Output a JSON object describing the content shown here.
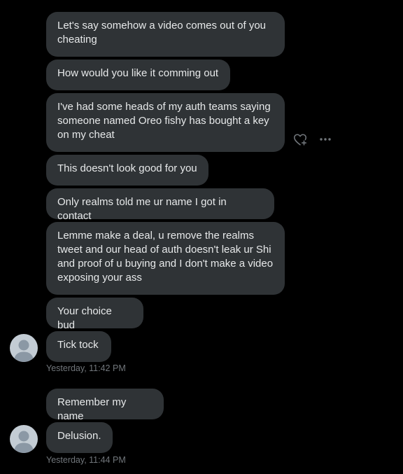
{
  "messages": [
    {
      "text": "Let's say somehow a video comes out of you cheating"
    },
    {
      "text": "How would you like it comming out"
    },
    {
      "text": "I've had some heads of my auth teams saying someone named Oreo fishy has bought a key on my cheat"
    },
    {
      "text": "This doesn't look good for you"
    },
    {
      "text": "Only realms told me ur name I got in contact"
    },
    {
      "text": "Lemme make a deal, u remove the realms tweet and our head of auth doesn't leak ur Shi and proof of u buying and I don't make a video exposing your ass"
    },
    {
      "text": "Your choice bud"
    },
    {
      "text": "Tick tock"
    },
    {
      "text": "Remember my name"
    },
    {
      "text": "Delusion."
    }
  ],
  "timestamps": [
    "Yesterday, 11:42 PM",
    "Yesterday, 11:44 PM"
  ],
  "icons": {
    "react": "heart-plus-icon",
    "more": "more-options-icon",
    "avatar": "default-avatar-icon"
  },
  "colors": {
    "background": "#000000",
    "bubble": "#2f3336",
    "text": "#e7e9ea",
    "muted": "#71767b"
  }
}
